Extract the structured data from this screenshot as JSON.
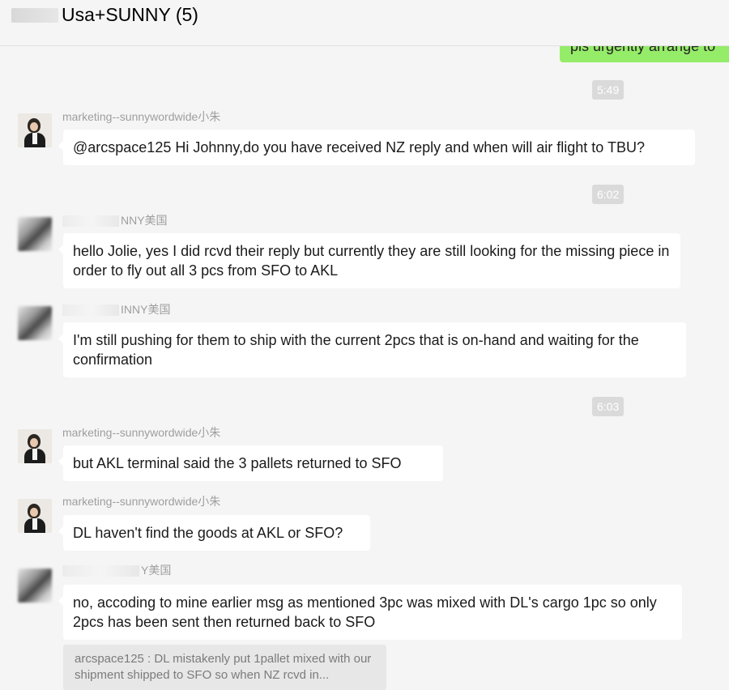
{
  "header": {
    "title": "Usa+SUNNY (5)"
  },
  "messages": {
    "green_partial": "pls urgently arrange to",
    "time1": "5:49",
    "m1": {
      "sender": "marketing--sunnywordwide小朱",
      "text": "@arcspace125 Hi Johnny,do you have received NZ reply and when will air flight to TBU?"
    },
    "time2": "6:02",
    "m2": {
      "sender": "NNY美国",
      "text": "hello Jolie, yes I did rcvd their reply but currently they are still looking for the missing piece in order to fly out all 3 pcs from SFO to AKL"
    },
    "m3": {
      "sender": "INNY美国",
      "text": "I'm still pushing for them to ship with the current 2pcs that is on-hand and waiting for the confirmation"
    },
    "time3": "6:03",
    "m4": {
      "sender": "marketing--sunnywordwide小朱",
      "text": "but AKL terminal said the 3 pallets returned to SFO"
    },
    "m5": {
      "sender": "marketing--sunnywordwide小朱",
      "text": "DL haven't find the goods at AKL or SFO?"
    },
    "m6": {
      "sender": "Y美国",
      "text": "no, accoding to mine earlier msg as mentioned 3pc was mixed with DL's cargo 1pc so only 2pcs has been sent then returned back to SFO"
    },
    "quote": "arcspace125 : DL mistakenly put 1pallet mixed with our shipment shipped to SFO so when NZ rcvd in..."
  }
}
